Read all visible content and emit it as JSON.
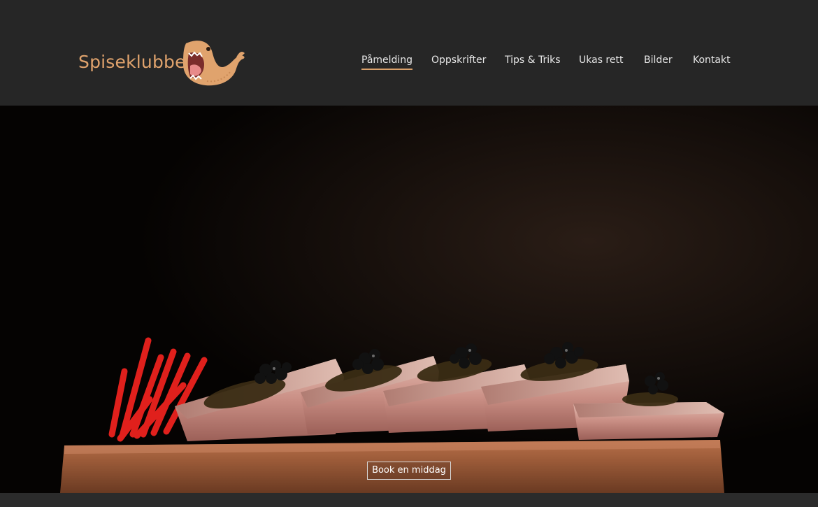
{
  "brand": {
    "name": "Spiseklubben",
    "accent": "#e0a36d"
  },
  "nav": {
    "items": [
      {
        "label": "Påmelding",
        "active": true
      },
      {
        "label": "Oppskrifter",
        "active": false
      },
      {
        "label": "Tips & Triks",
        "active": false
      },
      {
        "label": "Ukas rett",
        "active": false
      },
      {
        "label": "Bilder",
        "active": false
      },
      {
        "label": "Kontakt",
        "active": false
      }
    ]
  },
  "hero": {
    "cta_label": "Book en middag",
    "image_subject": "fish slices with caviar on a salt block"
  },
  "colors": {
    "header_bg": "#262626",
    "nav_text": "#e7e7e7",
    "active_underline": "#d9a06a"
  }
}
